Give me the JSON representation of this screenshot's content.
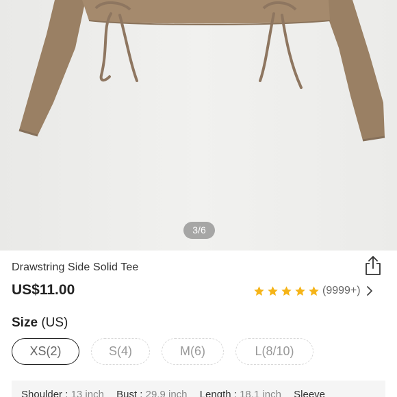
{
  "gallery": {
    "page_indicator": "3/6"
  },
  "product": {
    "title": "Drawstring Side Solid Tee",
    "price": "US$11.00",
    "rating": {
      "stars": 5,
      "review_count": "(9999+)"
    }
  },
  "size": {
    "label": "Size",
    "unit": "(US)",
    "options": [
      {
        "label": "XS(2)",
        "selected": true
      },
      {
        "label": "S(4)",
        "selected": false
      },
      {
        "label": "M(6)",
        "selected": false
      },
      {
        "label": "L(8/10)",
        "selected": false
      }
    ]
  },
  "measurements": [
    {
      "label": "Shoulder :",
      "value": "13 inch"
    },
    {
      "label": "Bust :",
      "value": "29.9 inch"
    },
    {
      "label": "Length :",
      "value": "18.1 inch"
    },
    {
      "label": "Sleeve",
      "value": ""
    }
  ],
  "colors": {
    "star": "#f5b418",
    "garment": "#9a8064"
  },
  "icons": {
    "share": "share-icon",
    "chevron": "chevron-right-icon",
    "star": "star-icon"
  }
}
